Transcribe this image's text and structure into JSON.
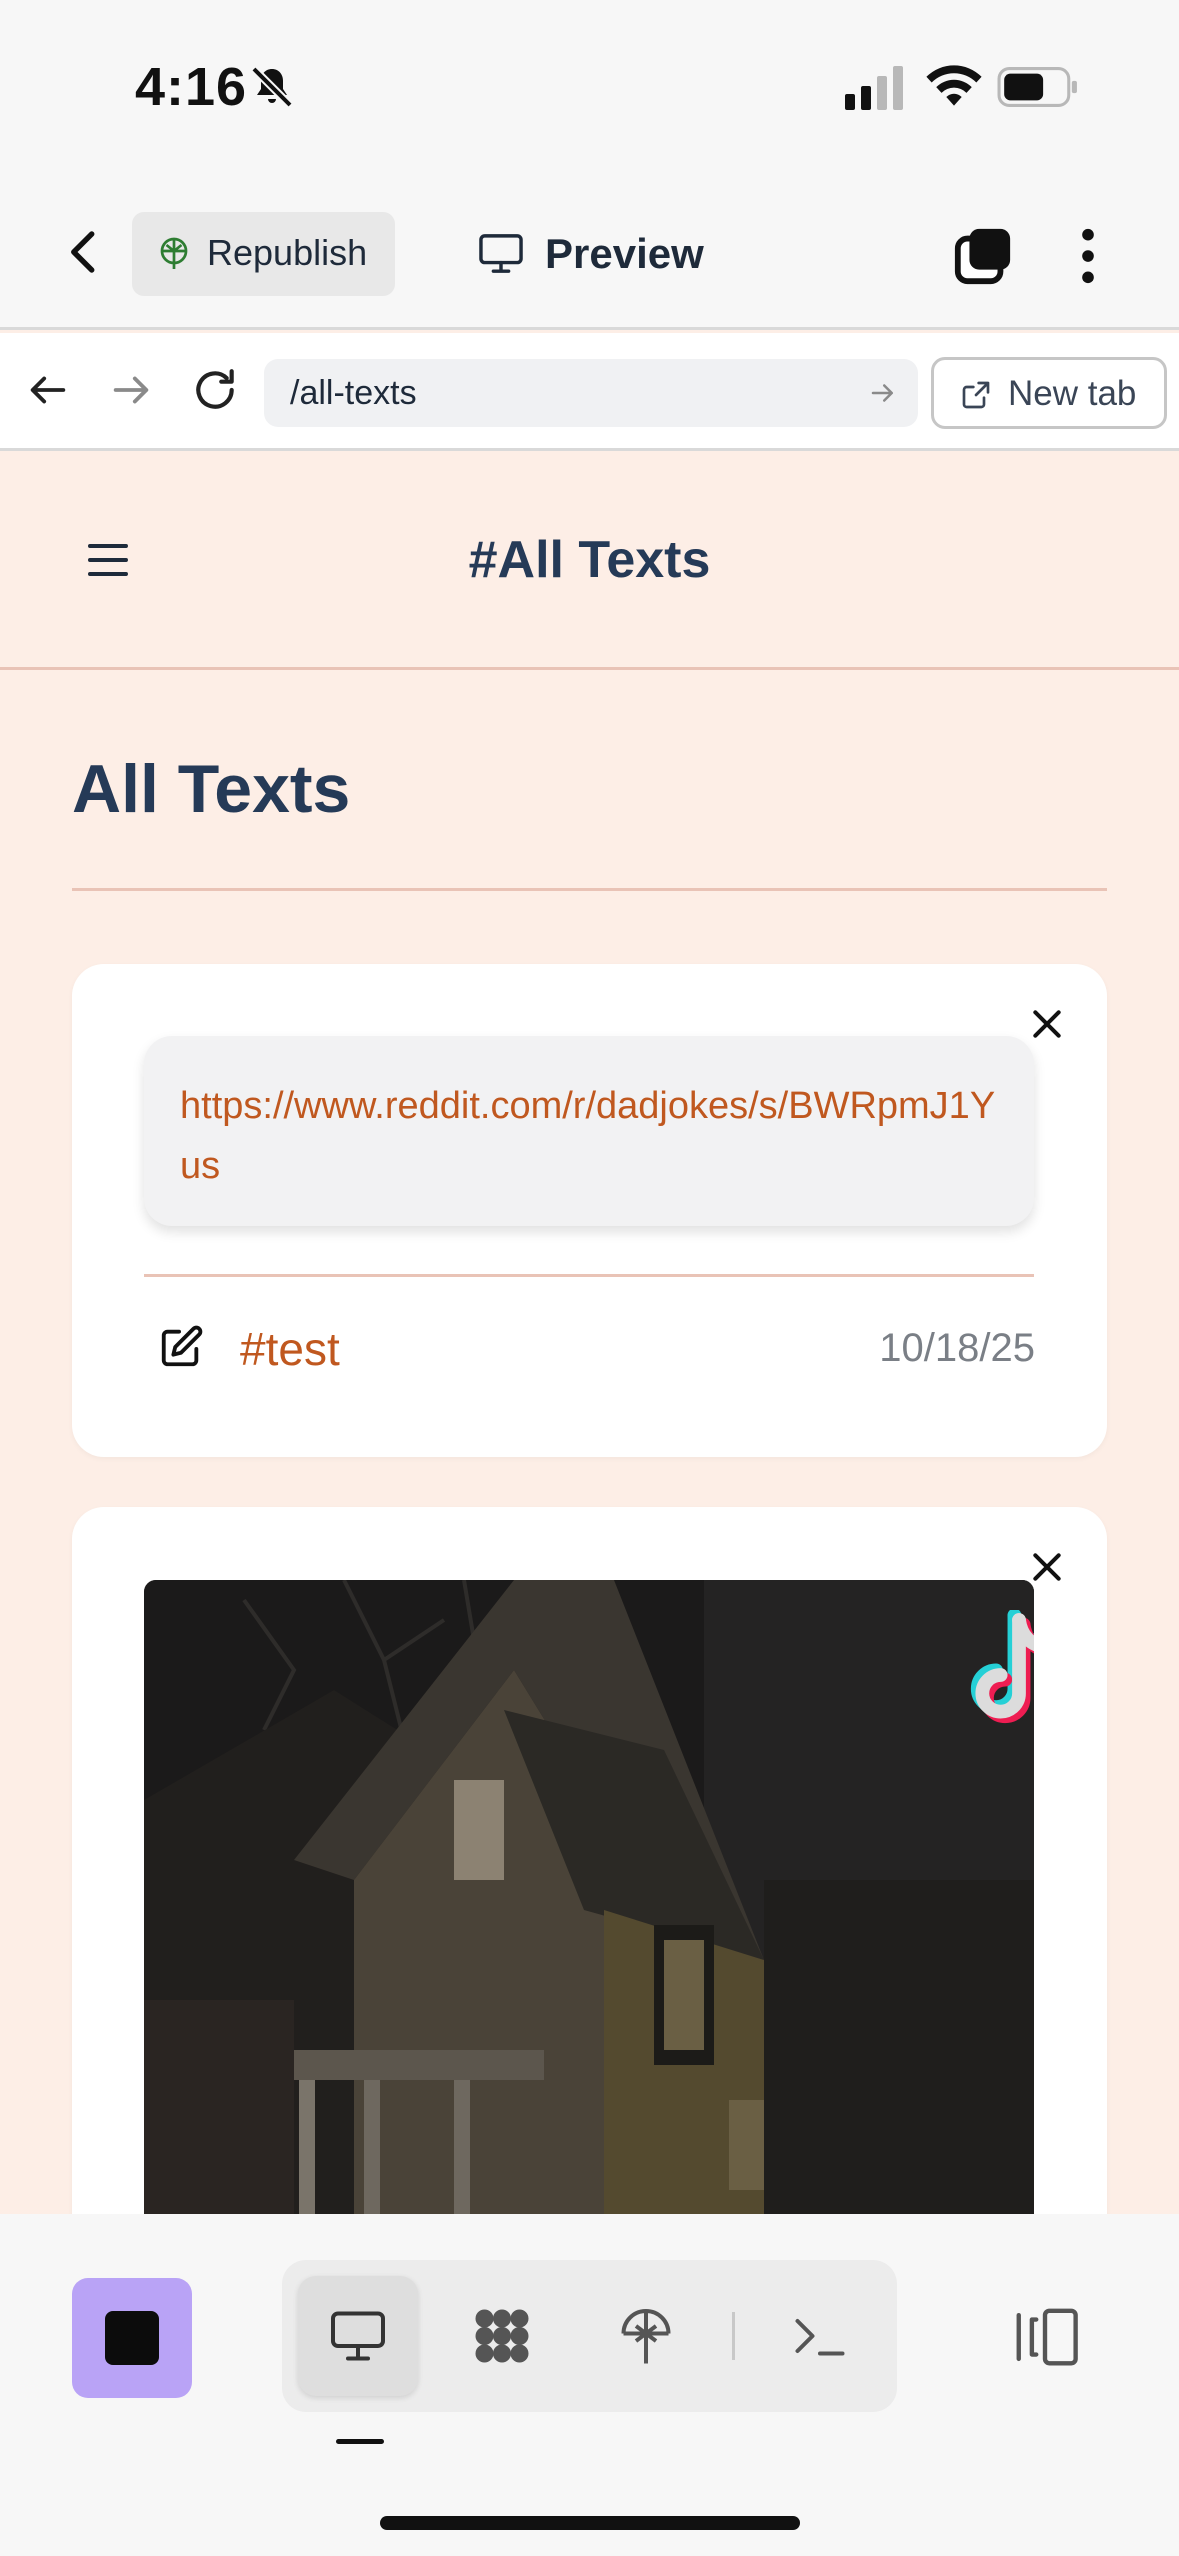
{
  "status_bar": {
    "time": "4:16"
  },
  "toolbar": {
    "republish_label": "Republish",
    "preview_label": "Preview"
  },
  "browser": {
    "url": "/all-texts",
    "new_tab_label": "New tab"
  },
  "page": {
    "header_title": "#All Texts",
    "title": "All Texts"
  },
  "cards": [
    {
      "type": "link",
      "url_text": "https://www.reddit.com/r/dadjokes/s/BWRpmJ1Yus",
      "tag": "#test",
      "date": "10/18/25"
    },
    {
      "type": "video",
      "source_icon": "tiktok-icon"
    }
  ],
  "bottom_bar": {
    "icons": [
      "stop-icon",
      "desktop-icon",
      "dots-grid-icon",
      "deploy-icon",
      "terminal-icon",
      "panel-icon"
    ],
    "active_view": "desktop"
  },
  "colors": {
    "page_background": "#fdeee6",
    "accent_link": "#c0581f",
    "heading": "#253a57",
    "stop_button": "#b9a3f6"
  }
}
